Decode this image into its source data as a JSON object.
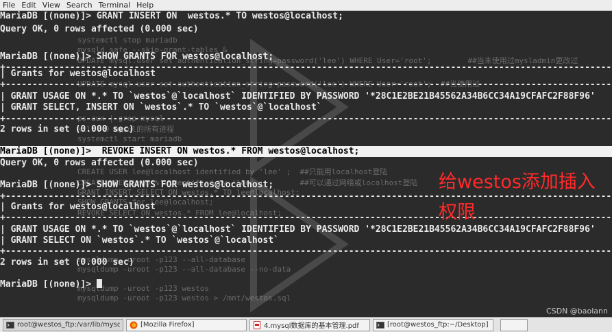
{
  "menubar": {
    "items": [
      "File",
      "Edit",
      "View",
      "Search",
      "Terminal",
      "Help"
    ]
  },
  "terminal": {
    "lines": [
      "MariaDB [(none)]> GRANT INSERT ON  westos.* TO westos@localhost;",
      "Query OK, 0 rows affected (0.000 sec)",
      "",
      "MariaDB [(none)]> SHOW GRANTS FOR westos@localhost;",
      "+--------------------------------------------------------------------------------------------------------------------",
      "| Grants for westos@localhost",
      "+--------------------------------------------------------------------------------------------------------------------",
      "| GRANT USAGE ON *.* TO `westos`@`localhost` IDENTIFIED BY PASSWORD '*28C1E2BE21B45562A34B6CC34A19CFAFC2F88F96'",
      "| GRANT SELECT, INSERT ON `westos`.* TO `westos`@`localhost`",
      "+--------------------------------------------------------------------------------------------------------------------",
      "2 rows in set (0.000 sec)",
      "",
      "MariaDB [(none)]>  REVOKE INSERT ON westos.* FROM westos@localhost;",
      "Query OK, 0 rows affected (0.000 sec)",
      "",
      "MariaDB [(none)]> SHOW GRANTS FOR westos@localhost;",
      "+--------------------------------------------------------------------------------------------------------------------",
      "| Grants for westos@localhost",
      "+--------------------------------------------------------------------------------------------------------------------",
      "| GRANT USAGE ON *.* TO `westos`@`localhost` IDENTIFIED BY PASSWORD '*28C1E2BE21B45562A34B6CC34A19CFAFC2F88F96'",
      "| GRANT SELECT ON `westos`.* TO `westos`@`localhost`",
      "+--------------------------------------------------------------------------------------------------------------------",
      "2 rows in set (0.000 sec)",
      "",
      "MariaDB [(none)]> "
    ],
    "ghost_lines": [
      {
        "text": "systemctl stop mariadb",
        "row": 2
      },
      {
        "text": "mysqld_safe --skip-grant-tables &",
        "row": 3
      },
      {
        "text": "UPDATE mysql.user set authentication_string=password('lee') WHERE User='root';        ##当未使用过mysladmin更改过",
        "row": 4
      },
      {
        "text": "UPDATE mysql.user set authentication_string=password('lee') WHERE User='root';  ##当使用过",
        "row": 7
      },
      {
        "text": "ps aux | grep mysql",
        "row": 10
      },
      {
        "text": "kill -9 mysql的所有进程",
        "row": 11
      },
      {
        "text": "systemctl start mariadb",
        "row": 12
      },
      {
        "text": "CREATE USER lee@localhost identified by 'lee' ;  ##只能用localhost登陆",
        "row": 16
      },
      {
        "text": "CREATE USER lee@'%' identified by 'lee' ;        ##可以通过网络或localhost登陆",
        "row": 17
      },
      {
        "text": "GRANT INSERT,SELECT ON westos.* TO lee@localhost;",
        "row": 18
      },
      {
        "text": "SHOW GRANTS for lee@localhost;",
        "row": 19
      },
      {
        "text": "REVOKE SELECT ON westos.* FROM lee@localhost;",
        "row": 20
      },
      {
        "text": "mysqldump -uroot -p123 --all-database",
        "row": 25
      },
      {
        "text": "mysqldump -uroot -p123 --all-database --no-data",
        "row": 26
      },
      {
        "text": "mysqldump -uroot -p123 westos",
        "row": 28
      },
      {
        "text": "mysqldump -uroot -p123 westos > /mnt/westos.sql",
        "row": 29
      }
    ]
  },
  "annotation": {
    "text": "给westos添加插入权限"
  },
  "taskbar": {
    "items": [
      {
        "label": "root@westos_ftp:/var/lib/mysql",
        "icon": "terminal-icon"
      },
      {
        "label": "[Mozilla Firefox]",
        "icon": "firefox-icon"
      },
      {
        "label": "4.mysql数据库的基本管理.pdf",
        "icon": "pdf-icon"
      },
      {
        "label": "[root@westos_ftp:~/Desktop]",
        "icon": "terminal-icon"
      }
    ]
  },
  "credit": "CSDN @baolann",
  "colors": {
    "terminal_bg": "#2b2b2b",
    "annotation": "#ff2a2a",
    "highlight_bg": "#f2f2f2"
  }
}
